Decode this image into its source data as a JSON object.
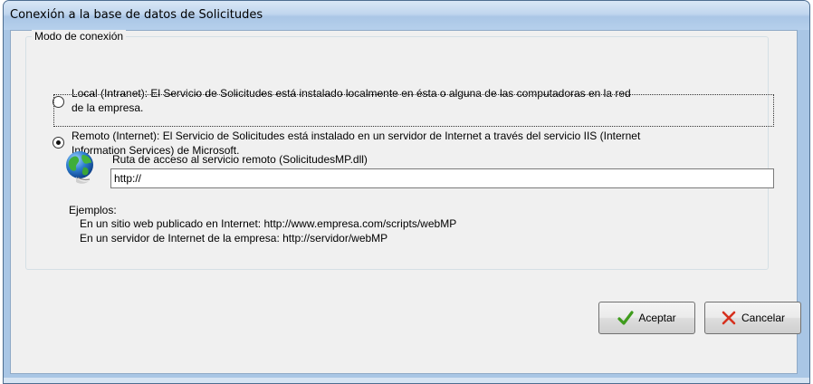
{
  "window": {
    "title": "Conexión a la base de datos de Solicitudes"
  },
  "group": {
    "label": "Modo de conexión"
  },
  "options": [
    {
      "line1": "Local (Intranet): El Servicio de Solicitudes está instalado localmente en ésta o alguna de las computadoras en la red",
      "line2": "de la empresa.",
      "checked": false
    },
    {
      "line1": "Remoto (Internet): El Servicio de Solicitudes está instalado en un servidor de Internet a través del servicio IIS (Internet",
      "line2": "Information Services) de Microsoft.",
      "checked": true
    }
  ],
  "remote": {
    "label": "Ruta de acceso al servicio remoto (SolicitudesMP.dll)",
    "value": "http://"
  },
  "examples": {
    "heading": "Ejemplos:",
    "lines": [
      "En un sitio web publicado en Internet:  http://www.empresa.com/scripts/webMP",
      "En un servidor de Internet de la empresa:  http://servidor/webMP"
    ]
  },
  "buttons": {
    "accept": "Aceptar",
    "cancel": "Cancelar"
  },
  "icons": {
    "remote_service": "globe-icon",
    "accept": "check-icon",
    "cancel": "x-icon"
  },
  "colors": {
    "accept_check": "#3f9c1d",
    "cancel_x": "#d6301e"
  }
}
